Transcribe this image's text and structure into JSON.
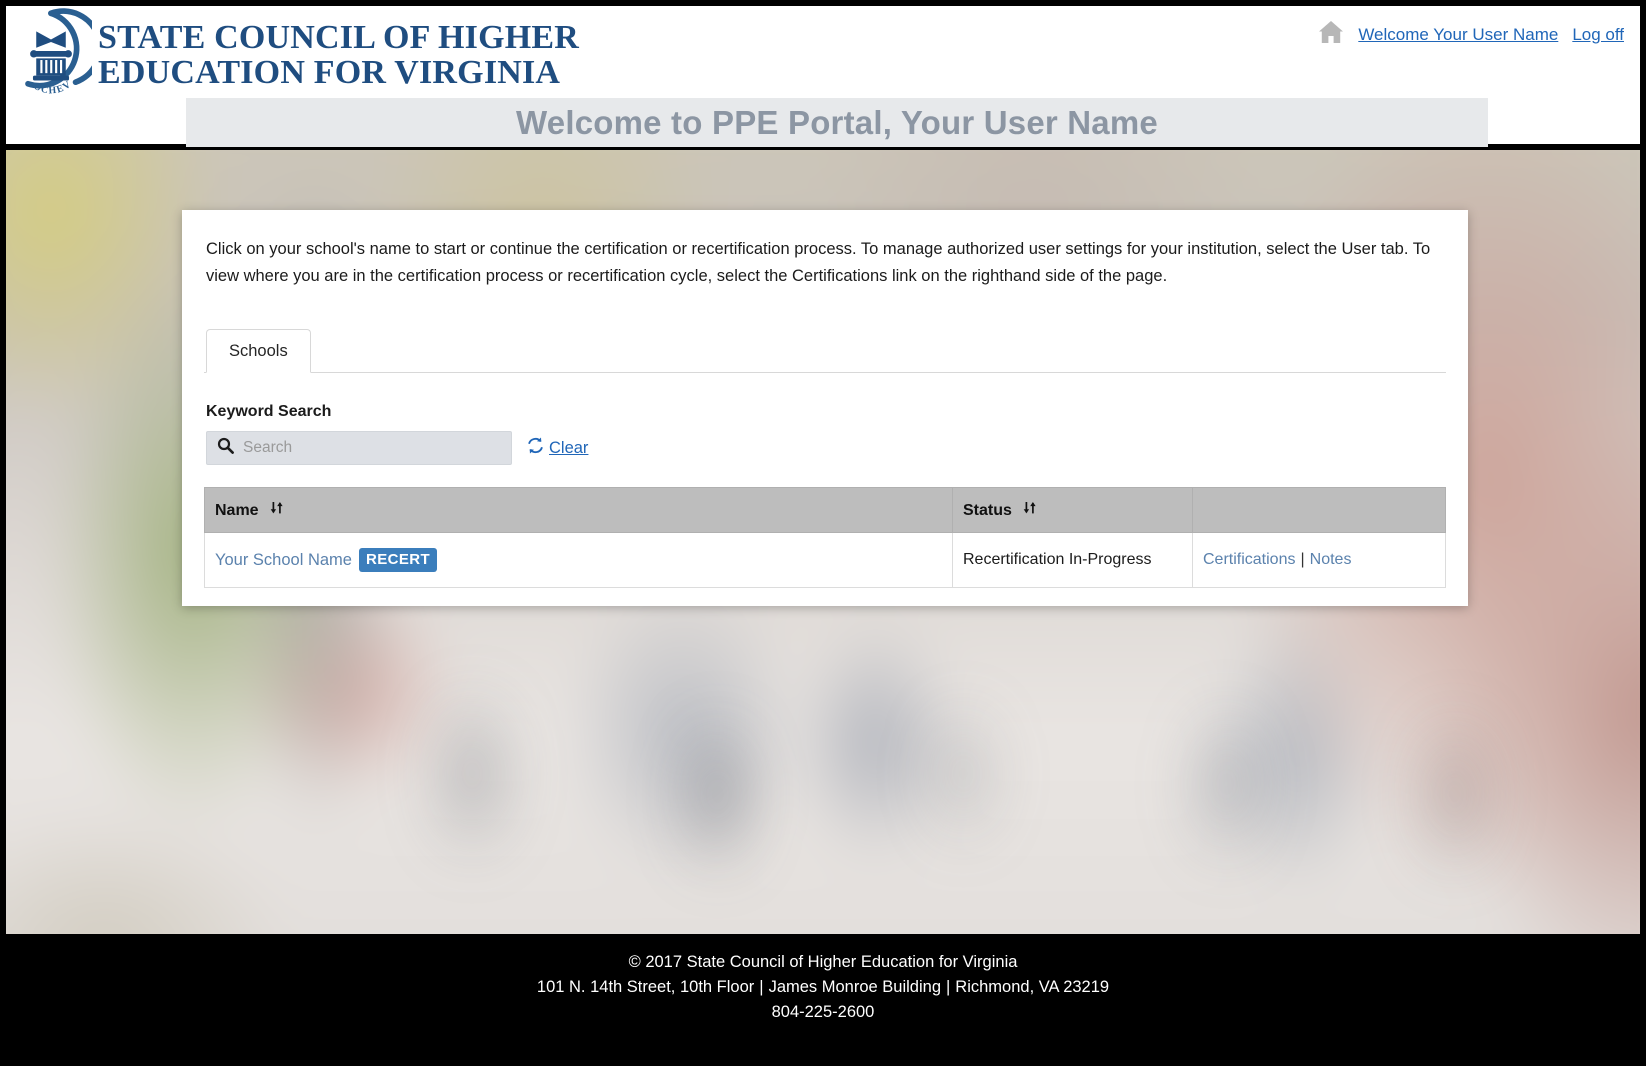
{
  "header": {
    "logo_alt": "SCHEV seal",
    "org_line1": "STATE COUNCIL OF HIGHER",
    "org_line2": "EDUCATION FOR VIRGINIA",
    "logo_text": "SCHEV",
    "home_icon": "home-icon",
    "welcome_link": "Welcome Your User Name",
    "logoff_link": "Log off"
  },
  "banner": {
    "title": "Welcome to PPE Portal, Your User Name",
    "background": "#e7e9eb",
    "text_color": "#8c96a3"
  },
  "main": {
    "intro": "Click on your school's name to start or continue the certification or recertification process. To manage authorized user settings for your institution, select the User tab. To view where you are in the certification process or recertification cycle, select the Certifications link on the righthand side of the page.",
    "tabs": [
      {
        "label": "Schools",
        "active": true
      }
    ],
    "search": {
      "label": "Keyword Search",
      "placeholder": "Search",
      "value": "",
      "icon": "search-icon",
      "clear_label": "Clear",
      "clear_icon": "refresh-icon",
      "clear_color": "#2066b8"
    },
    "table": {
      "columns": [
        {
          "header": "Name",
          "sortable": true,
          "sort_icon": "sort-icon"
        },
        {
          "header": "Status",
          "sortable": true,
          "sort_icon": "sort-icon"
        },
        {
          "header": "",
          "sortable": false
        }
      ],
      "rows": [
        {
          "name": "Your School Name",
          "badge": "RECERT",
          "badge_color": "#3b7ebc",
          "status": "Recertification In-Progress",
          "link_certifications": "Certifications",
          "link_separator": "|",
          "link_notes": "Notes"
        }
      ]
    }
  },
  "footer": {
    "copyright": "© 2017 State Council of Higher Education for Virginia",
    "address_street": "101 N. 14th Street, 10th Floor",
    "address_sep1": "|",
    "address_building": "James Monroe Building",
    "address_sep2": "|",
    "address_city": "Richmond, VA 23219",
    "phone": "804-225-2600"
  },
  "colors": {
    "brand_blue": "#1f4d80",
    "link_blue": "#2066b8",
    "badge_blue": "#3b7ebc",
    "table_header_gray": "#bdbdbd",
    "banner_gray": "#e7e9eb"
  }
}
